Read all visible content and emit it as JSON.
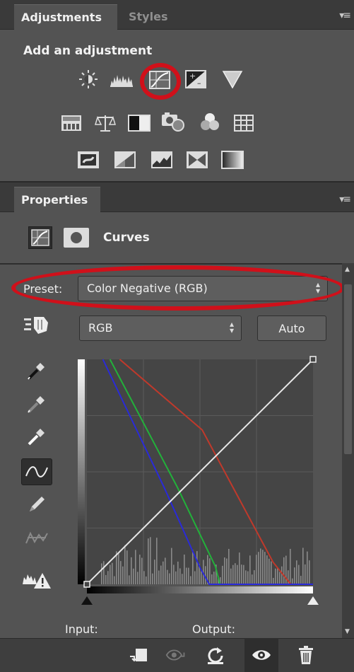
{
  "adjustments_panel": {
    "tabs": [
      {
        "label": "Adjustments"
      },
      {
        "label": "Styles"
      }
    ],
    "menu_glyph": "▾≡",
    "title": "Add an adjustment",
    "row1_icons": [
      "brightness-contrast-icon",
      "levels-icon",
      "curves-icon",
      "exposure-icon",
      "vibrance-icon"
    ],
    "row2_icons": [
      "hue-saturation-icon",
      "color-balance-icon",
      "black-white-icon",
      "photo-filter-icon",
      "channel-mixer-icon",
      "color-lookup-icon"
    ],
    "row3_icons": [
      "invert-icon",
      "posterize-icon",
      "threshold-icon",
      "selective-color-icon",
      "gradient-map-icon"
    ],
    "highlighted_icon": "curves-icon",
    "highlight_color": "#d0101a"
  },
  "properties_panel": {
    "tab_label": "Properties",
    "menu_glyph": "▾≡",
    "layer_type": "Curves",
    "preset_label": "Preset:",
    "preset_value": "Color Negative (RGB)",
    "channel_value": "RGB",
    "auto_button": "Auto",
    "tools": [
      "target-adjust-icon",
      "black-point-eyedropper-icon",
      "gray-point-eyedropper-icon",
      "white-point-eyedropper-icon",
      "curve-point-icon",
      "pencil-icon",
      "smooth-icon",
      "clipping-warning-icon"
    ],
    "selected_tool": "curve-point-icon",
    "input_label": "Input:",
    "output_label": "Output:",
    "footer_icons": [
      "clip-to-layer-icon",
      "view-previous-icon",
      "reset-icon",
      "visibility-eye-icon",
      "trash-icon"
    ]
  },
  "curves": {
    "colors": {
      "rgb": "#e8e8e8",
      "red": "#c0392b",
      "green": "#22b13a",
      "blue": "#2a2ad8"
    },
    "rgb_curve": [
      [
        0,
        0
      ],
      [
        255,
        255
      ]
    ],
    "red_curve": [
      [
        37,
        255
      ],
      [
        130,
        175
      ],
      [
        210,
        25
      ],
      [
        230,
        0
      ],
      [
        255,
        0
      ]
    ],
    "green_curve": [
      [
        26,
        255
      ],
      [
        102,
        110
      ],
      [
        145,
        20
      ],
      [
        150,
        0
      ],
      [
        255,
        0
      ]
    ],
    "blue_curve": [
      [
        18,
        255
      ],
      [
        87,
        110
      ],
      [
        128,
        18
      ],
      [
        138,
        0
      ],
      [
        255,
        0
      ]
    ]
  }
}
